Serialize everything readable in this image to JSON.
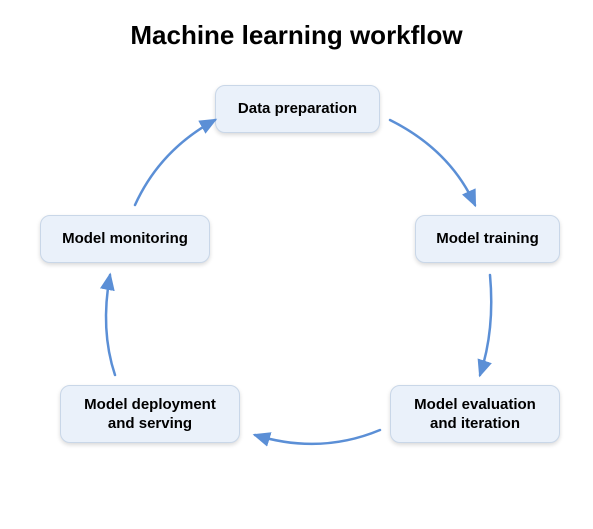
{
  "title": "Machine learning workflow",
  "nodes": [
    {
      "label": "Data preparation"
    },
    {
      "label": "Model training"
    },
    {
      "label": "Model evaluation\nand iteration"
    },
    {
      "label": "Model deployment\nand serving"
    },
    {
      "label": "Model monitoring"
    }
  ],
  "colors": {
    "node_bg": "#eaf1fa",
    "node_border": "#c9d7e8",
    "arrow": "#5b8fd6"
  }
}
